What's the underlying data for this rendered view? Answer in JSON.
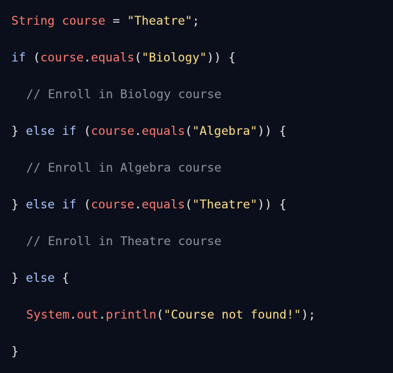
{
  "code": {
    "language": "Java",
    "lines": [
      [
        {
          "t": "String",
          "c": "ty"
        },
        {
          "t": " ",
          "c": "pn"
        },
        {
          "t": "course",
          "c": "id"
        },
        {
          "t": " = ",
          "c": "pn"
        },
        {
          "t": "\"Theatre\"",
          "c": "st"
        },
        {
          "t": ";",
          "c": "pn"
        }
      ],
      [
        {
          "t": "if",
          "c": "kw"
        },
        {
          "t": " (",
          "c": "pn"
        },
        {
          "t": "course",
          "c": "id"
        },
        {
          "t": ".",
          "c": "pn"
        },
        {
          "t": "equals",
          "c": "fn"
        },
        {
          "t": "(",
          "c": "pn"
        },
        {
          "t": "\"Biology\"",
          "c": "st"
        },
        {
          "t": ")) {",
          "c": "pn"
        }
      ],
      [
        {
          "t": "// Enroll in Biology course",
          "c": "cm"
        }
      ],
      [
        {
          "t": "} ",
          "c": "pn"
        },
        {
          "t": "else",
          "c": "kw"
        },
        {
          "t": " ",
          "c": "pn"
        },
        {
          "t": "if",
          "c": "kw"
        },
        {
          "t": " (",
          "c": "pn"
        },
        {
          "t": "course",
          "c": "id"
        },
        {
          "t": ".",
          "c": "pn"
        },
        {
          "t": "equals",
          "c": "fn"
        },
        {
          "t": "(",
          "c": "pn"
        },
        {
          "t": "\"Algebra\"",
          "c": "st"
        },
        {
          "t": ")) {",
          "c": "pn"
        }
      ],
      [
        {
          "t": "// Enroll in Algebra course",
          "c": "cm"
        }
      ],
      [
        {
          "t": "} ",
          "c": "pn"
        },
        {
          "t": "else",
          "c": "kw"
        },
        {
          "t": " ",
          "c": "pn"
        },
        {
          "t": "if",
          "c": "kw"
        },
        {
          "t": " (",
          "c": "pn"
        },
        {
          "t": "course",
          "c": "id"
        },
        {
          "t": ".",
          "c": "pn"
        },
        {
          "t": "equals",
          "c": "fn"
        },
        {
          "t": "(",
          "c": "pn"
        },
        {
          "t": "\"Theatre\"",
          "c": "st"
        },
        {
          "t": ")) {",
          "c": "pn"
        }
      ],
      [
        {
          "t": "// Enroll in Theatre course",
          "c": "cm"
        }
      ],
      [
        {
          "t": "} ",
          "c": "pn"
        },
        {
          "t": "else",
          "c": "kw"
        },
        {
          "t": " {",
          "c": "pn"
        }
      ],
      [
        {
          "t": "System",
          "c": "ty"
        },
        {
          "t": ".",
          "c": "pn"
        },
        {
          "t": "out",
          "c": "id"
        },
        {
          "t": ".",
          "c": "pn"
        },
        {
          "t": "println",
          "c": "fn"
        },
        {
          "t": "(",
          "c": "pn"
        },
        {
          "t": "\"Course not found!\"",
          "c": "st"
        },
        {
          "t": ");",
          "c": "pn"
        }
      ],
      [
        {
          "t": "}",
          "c": "pn"
        }
      ]
    ]
  },
  "colors": {
    "background": "#0b0f1b",
    "keyword": "#a9c7ff",
    "identifier": "#ff7b72",
    "string": "#ffe08a",
    "comment": "#8b93a1",
    "punctuation": "#e6e6e6"
  }
}
